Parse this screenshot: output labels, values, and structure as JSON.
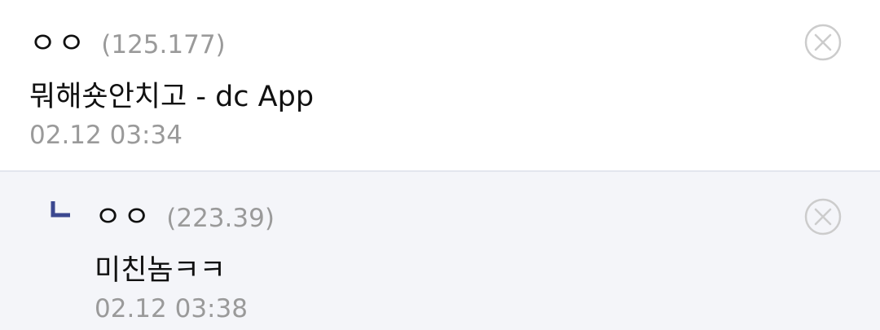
{
  "comments": [
    {
      "nickname": "ㅇㅇ",
      "ip": "(125.177)",
      "text": "뭐해숏안치고 - dc App",
      "date": "02.12 03:34"
    },
    {
      "nickname": "ㅇㅇ",
      "ip": "(223.39)",
      "text": "미친놈ㅋㅋ",
      "date": "02.12 03:38"
    }
  ],
  "colors": {
    "reply_background": "#f4f5f9",
    "reply_marker": "#3b4890",
    "meta_text": "#9a9a9a",
    "delete_icon": "#cccccc"
  },
  "icons": {
    "delete": "close-circle-icon",
    "reply_marker": "reply-arrow-icon"
  }
}
